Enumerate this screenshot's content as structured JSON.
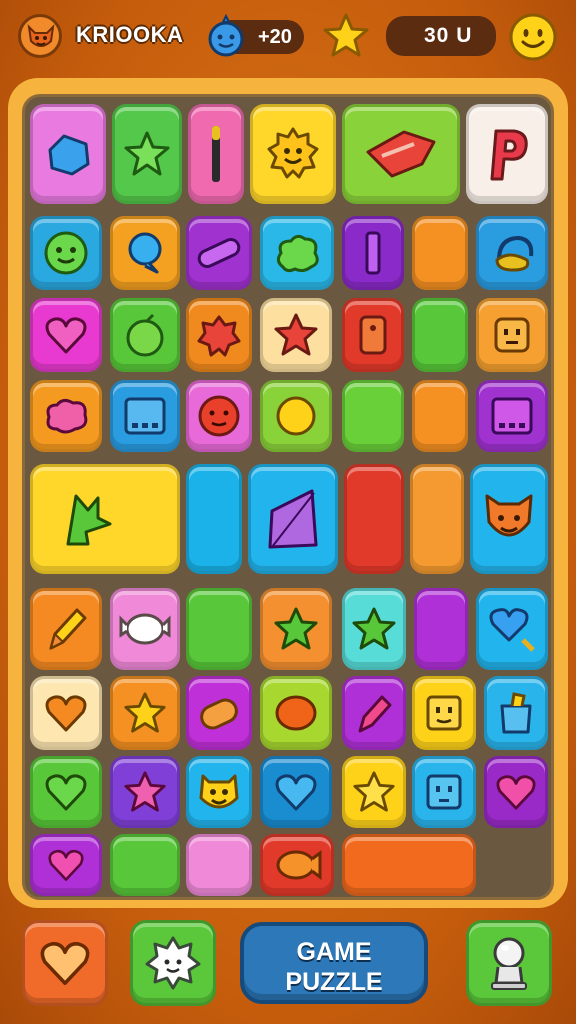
{
  "header": {
    "player_name": "KRIOOKA",
    "moves_value": "+20",
    "score_value": "30 U",
    "icons": [
      "fox-avatar-icon",
      "blue-creature-icon",
      "star-icon",
      "smiley-face-icon"
    ]
  },
  "footer": {
    "game_title_line1": "GAME",
    "game_title_line2": "PUZZLE",
    "buttons": [
      "heart-button",
      "cloud-character-button",
      "game-puzzle-button",
      "robot-button"
    ]
  },
  "colors": {
    "background": "#c45c0c",
    "board_frame": "#f6b33e",
    "board": "#6b5840",
    "accent_blue": "#2c78b8"
  }
}
